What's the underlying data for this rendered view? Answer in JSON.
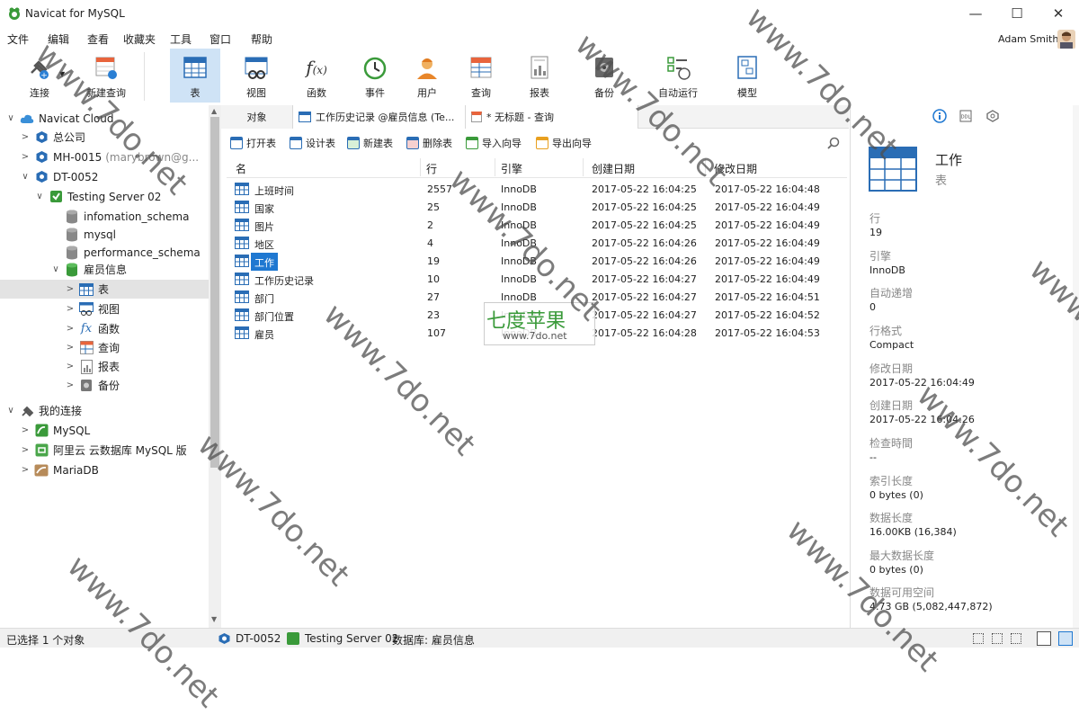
{
  "window": {
    "title": "Navicat for MySQL",
    "controls": [
      "—",
      "☐",
      "✕"
    ]
  },
  "menu": [
    "文件",
    "编辑",
    "查看",
    "收藏夹",
    "工具",
    "窗口",
    "帮助"
  ],
  "user": {
    "name": "Adam Smith"
  },
  "toolbar": {
    "connect": "连接",
    "new_query": "新建查询",
    "table": "表",
    "view": "视图",
    "function": "函数",
    "event": "事件",
    "user": "用户",
    "query": "查询",
    "report": "报表",
    "backup": "备份",
    "automation": "自动运行",
    "model": "模型"
  },
  "tree": [
    {
      "label": "Navicat Cloud"
    },
    {
      "label": "总公司"
    },
    {
      "label": "MH-0015",
      "sub": "(marybrown@g..."
    },
    {
      "label": "DT-0052"
    },
    {
      "label": "Testing Server 02"
    },
    {
      "label": "infomation_schema"
    },
    {
      "label": "mysql"
    },
    {
      "label": "performance_schema"
    },
    {
      "label": "雇员信息"
    },
    {
      "label": "表"
    },
    {
      "label": "视图"
    },
    {
      "label": "函数"
    },
    {
      "label": "查询"
    },
    {
      "label": "报表"
    },
    {
      "label": "备份"
    },
    {
      "label": "我的连接"
    },
    {
      "label": "MySQL"
    },
    {
      "label": "阿里云 云数据库 MySQL 版"
    },
    {
      "label": "MariaDB"
    }
  ],
  "tabs": [
    "对象",
    "工作历史记录 @雇员信息 (Te...",
    "* 无标题 - 查询"
  ],
  "objbar": {
    "open": "打开表",
    "design": "设计表",
    "new": "新建表",
    "delete": "删除表",
    "import": "导入向导",
    "export": "导出向导"
  },
  "table": {
    "headers": [
      "名",
      "行",
      "引擎",
      "创建日期",
      "修改日期"
    ],
    "rows": [
      [
        "上班时间",
        "2557",
        "InnoDB",
        "2017-05-22 16:04:25",
        "2017-05-22 16:04:48"
      ],
      [
        "国家",
        "25",
        "InnoDB",
        "2017-05-22 16:04:25",
        "2017-05-22 16:04:49"
      ],
      [
        "图片",
        "2",
        "InnoDB",
        "2017-05-22 16:04:25",
        "2017-05-22 16:04:49"
      ],
      [
        "地区",
        "4",
        "InnoDB",
        "2017-05-22 16:04:26",
        "2017-05-22 16:04:49"
      ],
      [
        "工作",
        "19",
        "InnoDB",
        "2017-05-22 16:04:26",
        "2017-05-22 16:04:49"
      ],
      [
        "工作历史记录",
        "10",
        "InnoDB",
        "2017-05-22 16:04:27",
        "2017-05-22 16:04:49"
      ],
      [
        "部门",
        "27",
        "InnoDB",
        "2017-05-22 16:04:27",
        "2017-05-22 16:04:51"
      ],
      [
        "部门位置",
        "23",
        "InnoDB",
        "2017-05-22 16:04:27",
        "2017-05-22 16:04:52"
      ],
      [
        "雇员",
        "107",
        "InnoDB",
        "2017-05-22 16:04:28",
        "2017-05-22 16:04:53"
      ]
    ],
    "selected_index": 4
  },
  "details": {
    "name": "工作",
    "type": "表",
    "fields": [
      {
        "label": "行",
        "value": "19"
      },
      {
        "label": "引擎",
        "value": "InnoDB"
      },
      {
        "label": "自动递增",
        "value": "0"
      },
      {
        "label": "行格式",
        "value": "Compact"
      },
      {
        "label": "修改日期",
        "value": "2017-05-22 16:04:49"
      },
      {
        "label": "创建日期",
        "value": "2017-05-22 16:04:26"
      },
      {
        "label": "检查時間",
        "value": "--"
      },
      {
        "label": "索引长度",
        "value": "0 bytes (0)"
      },
      {
        "label": "数据长度",
        "value": "16.00KB (16,384)"
      },
      {
        "label": "最大数据长度",
        "value": "0 bytes (0)"
      },
      {
        "label": "数据可用空间",
        "value": "4.73 GB (5,082,447,872)"
      }
    ]
  },
  "status": {
    "selected": "已选择 1 个对象",
    "connection": "DT-0052",
    "server": "Testing Server 02",
    "database": "数据库: 雇员信息"
  },
  "watermark": {
    "brand": "七度苹果",
    "url": "www.7do.net",
    "text": "www.7do.net"
  },
  "colors": {
    "accent": "#1f78d1",
    "green": "#2ea043",
    "selection": "#cfe3f6"
  }
}
